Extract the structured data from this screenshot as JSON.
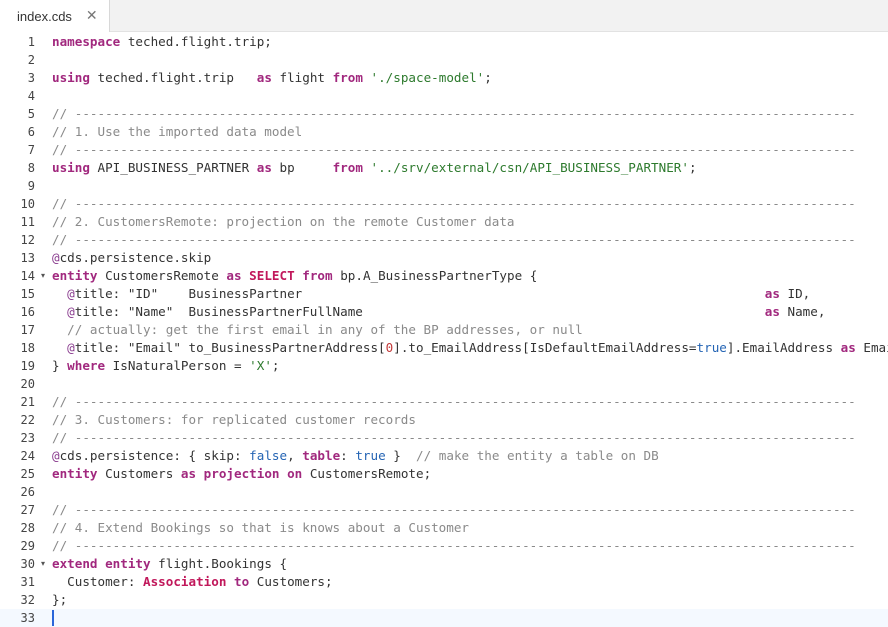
{
  "tab": {
    "title": "index.cds",
    "close_icon": "✕"
  },
  "colors": {
    "keyword": "#a1287e",
    "comment": "#8a8a8a",
    "string": "#2d7a2d",
    "annotation": "#8a3d8f",
    "boolean": "#2464b4",
    "number": "#c23a3a",
    "cursor": "#2a66d9"
  },
  "editor": {
    "fold_icon": "▾",
    "lines": [
      {
        "n": "1",
        "tokens": [
          {
            "t": "kw",
            "v": "namespace"
          },
          {
            "t": "plain",
            "v": " teched.flight.trip;"
          }
        ]
      },
      {
        "n": "2",
        "tokens": []
      },
      {
        "n": "3",
        "tokens": [
          {
            "t": "kw",
            "v": "using"
          },
          {
            "t": "plain",
            "v": " teched.flight.trip   "
          },
          {
            "t": "kw",
            "v": "as"
          },
          {
            "t": "plain",
            "v": " flight "
          },
          {
            "t": "kw",
            "v": "from"
          },
          {
            "t": "plain",
            "v": " "
          },
          {
            "t": "str",
            "v": "'./space-model'"
          },
          {
            "t": "plain",
            "v": ";"
          }
        ]
      },
      {
        "n": "4",
        "tokens": []
      },
      {
        "n": "5",
        "tokens": [
          {
            "t": "cmt",
            "v": "// -------------------------------------------------------------------------------------------------------"
          }
        ]
      },
      {
        "n": "6",
        "tokens": [
          {
            "t": "cmt",
            "v": "// 1. Use the imported data model"
          }
        ]
      },
      {
        "n": "7",
        "tokens": [
          {
            "t": "cmt",
            "v": "// -------------------------------------------------------------------------------------------------------"
          }
        ]
      },
      {
        "n": "8",
        "tokens": [
          {
            "t": "kw",
            "v": "using"
          },
          {
            "t": "plain",
            "v": " API_BUSINESS_PARTNER "
          },
          {
            "t": "kw",
            "v": "as"
          },
          {
            "t": "plain",
            "v": " bp     "
          },
          {
            "t": "kw",
            "v": "from"
          },
          {
            "t": "plain",
            "v": " "
          },
          {
            "t": "str",
            "v": "'../srv/external/csn/API_BUSINESS_PARTNER'"
          },
          {
            "t": "plain",
            "v": ";"
          }
        ]
      },
      {
        "n": "9",
        "tokens": []
      },
      {
        "n": "10",
        "tokens": [
          {
            "t": "cmt",
            "v": "// -------------------------------------------------------------------------------------------------------"
          }
        ]
      },
      {
        "n": "11",
        "tokens": [
          {
            "t": "cmt",
            "v": "// 2. CustomersRemote: projection on the remote Customer data"
          }
        ]
      },
      {
        "n": "12",
        "tokens": [
          {
            "t": "cmt",
            "v": "// -------------------------------------------------------------------------------------------------------"
          }
        ]
      },
      {
        "n": "13",
        "tokens": [
          {
            "t": "ann",
            "v": "@"
          },
          {
            "t": "plain",
            "v": "cds.persistence.skip"
          }
        ]
      },
      {
        "n": "14",
        "fold": true,
        "tokens": [
          {
            "t": "kw",
            "v": "entity"
          },
          {
            "t": "plain",
            "v": " CustomersRemote "
          },
          {
            "t": "kw",
            "v": "as"
          },
          {
            "t": "plain",
            "v": " "
          },
          {
            "t": "sel",
            "v": "SELECT"
          },
          {
            "t": "plain",
            "v": " "
          },
          {
            "t": "kw",
            "v": "from"
          },
          {
            "t": "plain",
            "v": " bp.A_BusinessPartnerType {"
          }
        ]
      },
      {
        "n": "15",
        "tokens": [
          {
            "t": "plain",
            "v": "  "
          },
          {
            "t": "ann",
            "v": "@"
          },
          {
            "t": "plain",
            "v": "title: \"ID\"    BusinessPartner                                                             "
          },
          {
            "t": "kw",
            "v": "as"
          },
          {
            "t": "plain",
            "v": " ID,"
          }
        ]
      },
      {
        "n": "16",
        "tokens": [
          {
            "t": "plain",
            "v": "  "
          },
          {
            "t": "ann",
            "v": "@"
          },
          {
            "t": "plain",
            "v": "title: \"Name\"  BusinessPartnerFullName                                                     "
          },
          {
            "t": "kw",
            "v": "as"
          },
          {
            "t": "plain",
            "v": " Name,"
          }
        ]
      },
      {
        "n": "17",
        "tokens": [
          {
            "t": "plain",
            "v": "  "
          },
          {
            "t": "cmt",
            "v": "// actually: get the first email in any of the BP addresses, or null"
          }
        ]
      },
      {
        "n": "18",
        "tokens": [
          {
            "t": "plain",
            "v": "  "
          },
          {
            "t": "ann",
            "v": "@"
          },
          {
            "t": "plain",
            "v": "title: \"Email\" to_BusinessPartnerAddress["
          },
          {
            "t": "num",
            "v": "0"
          },
          {
            "t": "plain",
            "v": "].to_EmailAddress[IsDefaultEmailAddress="
          },
          {
            "t": "bool",
            "v": "true"
          },
          {
            "t": "plain",
            "v": "].EmailAddress "
          },
          {
            "t": "kw",
            "v": "as"
          },
          {
            "t": "plain",
            "v": " Email"
          }
        ]
      },
      {
        "n": "19",
        "tokens": [
          {
            "t": "plain",
            "v": "} "
          },
          {
            "t": "kw",
            "v": "where"
          },
          {
            "t": "plain",
            "v": " IsNaturalPerson = "
          },
          {
            "t": "str",
            "v": "'X'"
          },
          {
            "t": "plain",
            "v": ";"
          }
        ]
      },
      {
        "n": "20",
        "tokens": []
      },
      {
        "n": "21",
        "tokens": [
          {
            "t": "cmt",
            "v": "// -------------------------------------------------------------------------------------------------------"
          }
        ]
      },
      {
        "n": "22",
        "tokens": [
          {
            "t": "cmt",
            "v": "// 3. Customers: for replicated customer records"
          }
        ]
      },
      {
        "n": "23",
        "tokens": [
          {
            "t": "cmt",
            "v": "// -------------------------------------------------------------------------------------------------------"
          }
        ]
      },
      {
        "n": "24",
        "tokens": [
          {
            "t": "ann",
            "v": "@"
          },
          {
            "t": "plain",
            "v": "cds.persistence: { skip: "
          },
          {
            "t": "bool",
            "v": "false"
          },
          {
            "t": "plain",
            "v": ", "
          },
          {
            "t": "kw",
            "v": "table"
          },
          {
            "t": "plain",
            "v": ": "
          },
          {
            "t": "bool",
            "v": "true"
          },
          {
            "t": "plain",
            "v": " }  "
          },
          {
            "t": "cmt",
            "v": "// make the entity a table on DB"
          }
        ]
      },
      {
        "n": "25",
        "tokens": [
          {
            "t": "kw",
            "v": "entity"
          },
          {
            "t": "plain",
            "v": " Customers "
          },
          {
            "t": "kw",
            "v": "as"
          },
          {
            "t": "plain",
            "v": " "
          },
          {
            "t": "kw",
            "v": "projection"
          },
          {
            "t": "plain",
            "v": " "
          },
          {
            "t": "kw",
            "v": "on"
          },
          {
            "t": "plain",
            "v": " CustomersRemote;"
          }
        ]
      },
      {
        "n": "26",
        "tokens": []
      },
      {
        "n": "27",
        "tokens": [
          {
            "t": "cmt",
            "v": "// -------------------------------------------------------------------------------------------------------"
          }
        ]
      },
      {
        "n": "28",
        "tokens": [
          {
            "t": "cmt",
            "v": "// 4. Extend Bookings so that is knows about a Customer"
          }
        ]
      },
      {
        "n": "29",
        "tokens": [
          {
            "t": "cmt",
            "v": "// -------------------------------------------------------------------------------------------------------"
          }
        ]
      },
      {
        "n": "30",
        "fold": true,
        "tokens": [
          {
            "t": "kw",
            "v": "extend"
          },
          {
            "t": "plain",
            "v": " "
          },
          {
            "t": "kw",
            "v": "entity"
          },
          {
            "t": "plain",
            "v": " flight.Bookings {"
          }
        ]
      },
      {
        "n": "31",
        "tokens": [
          {
            "t": "plain",
            "v": "  Customer: "
          },
          {
            "t": "sel",
            "v": "Association"
          },
          {
            "t": "plain",
            "v": " "
          },
          {
            "t": "kw",
            "v": "to"
          },
          {
            "t": "plain",
            "v": " Customers;"
          }
        ]
      },
      {
        "n": "32",
        "tokens": [
          {
            "t": "plain",
            "v": "};"
          }
        ]
      },
      {
        "n": "33",
        "active": true,
        "tokens": []
      }
    ]
  }
}
